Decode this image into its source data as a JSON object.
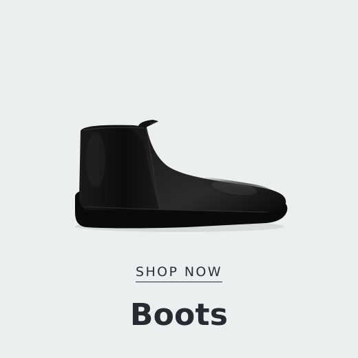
{
  "card": {
    "cta_label": "SHOP NOW",
    "category_title": "Boots",
    "product_icon": "ankle-boot-icon"
  },
  "colors": {
    "background": "#eceff0",
    "text": "#262a31",
    "boot": "#111111"
  }
}
